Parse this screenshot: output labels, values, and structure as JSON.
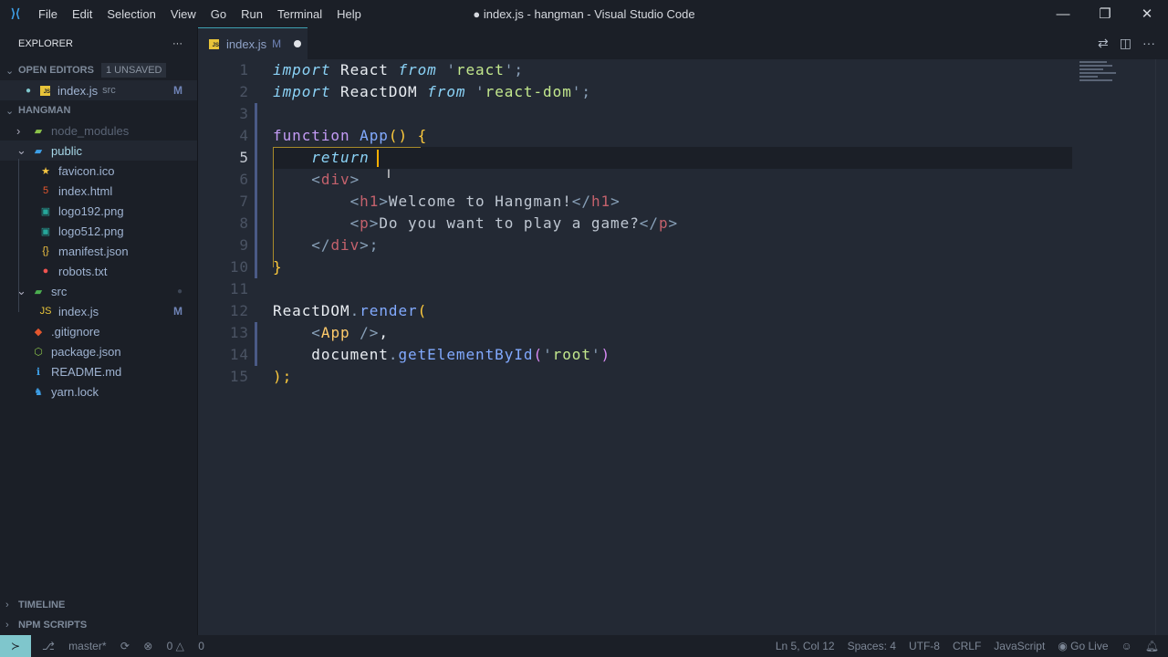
{
  "titlebar": {
    "menu": [
      "File",
      "Edit",
      "Selection",
      "View",
      "Go",
      "Run",
      "Terminal",
      "Help"
    ],
    "title": "● index.js - hangman - Visual Studio Code"
  },
  "sidebar": {
    "title": "EXPLORER",
    "open_editors": "OPEN EDITORS",
    "unsaved": "1 UNSAVED",
    "open_file": {
      "name": "index.js",
      "desc": "src",
      "status": "M"
    },
    "project": "HANGMAN",
    "tree": [
      {
        "name": "node_modules",
        "icon": "folder-icon",
        "color": "#5a6475",
        "ico": "▰",
        "icolor": "#8bc34a",
        "indent": 1,
        "chev": "›"
      },
      {
        "name": "public",
        "icon": "folder-open-icon",
        "color": "#a7d8e8",
        "ico": "▰",
        "icolor": "#3ea0e8",
        "indent": 1,
        "chev": "⌄",
        "sel": true
      },
      {
        "name": "favicon.ico",
        "icon": "star-icon",
        "ico": "★",
        "icolor": "#f4c542",
        "indent": 2
      },
      {
        "name": "index.html",
        "icon": "html-icon",
        "ico": "5",
        "icolor": "#e4572e",
        "indent": 2
      },
      {
        "name": "logo192.png",
        "icon": "image-icon",
        "ico": "▣",
        "icolor": "#26a69a",
        "indent": 2
      },
      {
        "name": "logo512.png",
        "icon": "image-icon",
        "ico": "▣",
        "icolor": "#26a69a",
        "indent": 2
      },
      {
        "name": "manifest.json",
        "icon": "json-icon",
        "ico": "{}",
        "icolor": "#f4c542",
        "indent": 2
      },
      {
        "name": "robots.txt",
        "icon": "robot-icon",
        "ico": "●",
        "icolor": "#ef5350",
        "indent": 2
      },
      {
        "name": "src",
        "icon": "folder-src-icon",
        "ico": "▰",
        "icolor": "#4caf50",
        "indent": 1,
        "chev": "⌄",
        "dot": "●"
      },
      {
        "name": "index.js",
        "icon": "js-icon",
        "ico": "JS",
        "icolor": "#e8c43a",
        "indent": 2,
        "status": "M"
      },
      {
        "name": ".gitignore",
        "icon": "git-icon",
        "ico": "◆",
        "icolor": "#e4572e",
        "indent": 1
      },
      {
        "name": "package.json",
        "icon": "nodejs-icon",
        "ico": "⬡",
        "icolor": "#8bc34a",
        "indent": 1
      },
      {
        "name": "README.md",
        "icon": "info-icon",
        "ico": "ℹ",
        "icolor": "#3ea0e8",
        "indent": 1
      },
      {
        "name": "yarn.lock",
        "icon": "yarn-icon",
        "ico": "♞",
        "icolor": "#3ea0e8",
        "indent": 1
      }
    ],
    "timeline": "TIMELINE",
    "npm": "NPM SCRIPTS"
  },
  "tab": {
    "name": "index.js",
    "status": "M"
  },
  "editor": {
    "lines": [
      [
        [
          "import",
          "kw"
        ],
        [
          " React ",
          "id"
        ],
        [
          "from",
          "kw"
        ],
        [
          " '",
          "pun"
        ],
        [
          "react",
          "str"
        ],
        [
          "';",
          "pun"
        ]
      ],
      [
        [
          "import",
          "kw"
        ],
        [
          " ReactDOM ",
          "id"
        ],
        [
          "from",
          "kw"
        ],
        [
          " '",
          "pun"
        ],
        [
          "react-dom",
          "str"
        ],
        [
          "';",
          "pun"
        ]
      ],
      [],
      [
        [
          "function",
          "kw2"
        ],
        [
          " App",
          "fn"
        ],
        [
          "()",
          "br"
        ],
        [
          " {",
          "br"
        ]
      ],
      [
        [
          "    return ",
          "kw"
        ]
      ],
      [
        [
          "    <",
          "tagp"
        ],
        [
          "div",
          "tag"
        ],
        [
          ">",
          "tagp"
        ]
      ],
      [
        [
          "        <",
          "tagp"
        ],
        [
          "h1",
          "tag"
        ],
        [
          ">",
          "tagp"
        ],
        [
          "Welcome to Hangman!",
          "txt"
        ],
        [
          "</",
          "tagp"
        ],
        [
          "h1",
          "tag"
        ],
        [
          ">",
          "tagp"
        ]
      ],
      [
        [
          "        <",
          "tagp"
        ],
        [
          "p",
          "tag"
        ],
        [
          ">",
          "tagp"
        ],
        [
          "Do you want to play a game?",
          "txt"
        ],
        [
          "</",
          "tagp"
        ],
        [
          "p",
          "tag"
        ],
        [
          ">",
          "tagp"
        ]
      ],
      [
        [
          "    </",
          "tagp"
        ],
        [
          "div",
          "tag"
        ],
        [
          ">;",
          "tagp"
        ]
      ],
      [
        [
          "}",
          "br"
        ]
      ],
      [],
      [
        [
          "ReactDOM",
          "id"
        ],
        [
          ".",
          "pun"
        ],
        [
          "render",
          "fn"
        ],
        [
          "(",
          "br"
        ]
      ],
      [
        [
          "    <",
          "tagp"
        ],
        [
          "App",
          "comp"
        ],
        [
          " />",
          "tagp"
        ],
        [
          ",",
          "id"
        ]
      ],
      [
        [
          "    document",
          "id"
        ],
        [
          ".",
          "pun"
        ],
        [
          "getElementById",
          "fn"
        ],
        [
          "(",
          "brp"
        ],
        [
          "'",
          "pun"
        ],
        [
          "root",
          "str"
        ],
        [
          "'",
          "pun"
        ],
        [
          ")",
          "brp"
        ]
      ],
      [
        [
          ");",
          "br"
        ]
      ]
    ],
    "current_line": 5
  },
  "status": {
    "branch": "master*",
    "errors": "0",
    "warnings": "0",
    "position": "Ln 5, Col 12",
    "spaces": "Spaces: 4",
    "encoding": "UTF-8",
    "eol": "CRLF",
    "language": "JavaScript",
    "golive": "Go Live"
  }
}
